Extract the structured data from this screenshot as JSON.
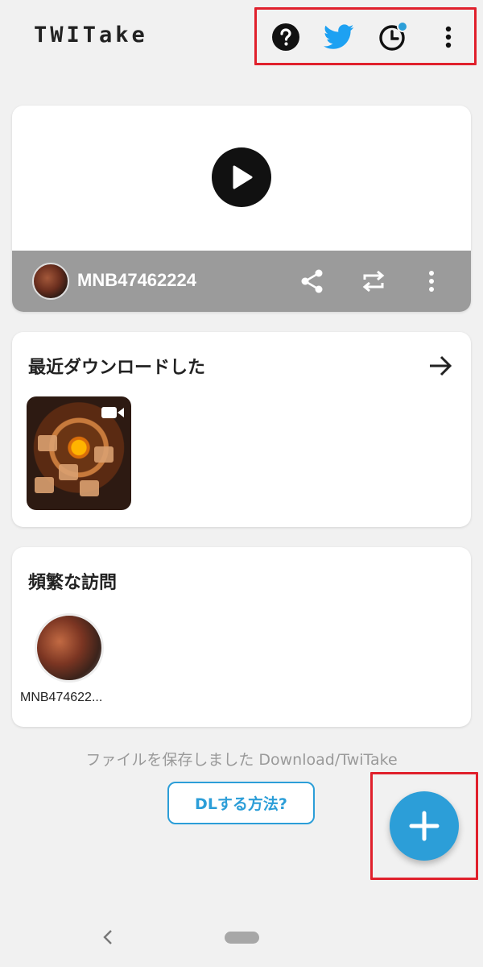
{
  "app": {
    "title": "TWITake"
  },
  "toolbar": {
    "icons": [
      "help-icon",
      "twitter-bird-icon",
      "history-icon",
      "more-vert-icon"
    ],
    "accent": "#1DA1F2",
    "badge_color": "#2C9ED8"
  },
  "player": {
    "username": "MNB47462224",
    "icons": [
      "play-icon",
      "share-icon",
      "repeat-icon",
      "more-vert-icon"
    ]
  },
  "recent": {
    "heading": "最近ダウンロードした",
    "icon": "arrow-right-icon"
  },
  "frequent": {
    "heading": "頻繁な訪問",
    "items": [
      {
        "name": "MNB474622..."
      }
    ]
  },
  "footer": {
    "saved_message": "ファイルを保存しました Download/TwiTake",
    "how_button": "DLする方法?"
  },
  "fab": {
    "icon": "plus-icon",
    "color": "#2C9ED8"
  },
  "highlight_color": "#E0202C"
}
